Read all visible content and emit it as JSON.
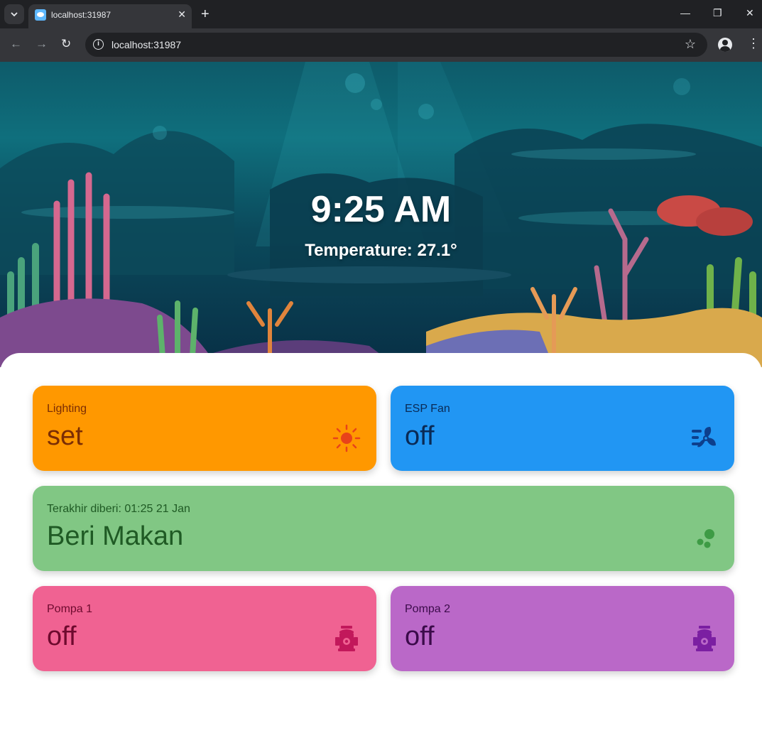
{
  "browser": {
    "tab_title": "localhost:31987",
    "url": "localhost:31987"
  },
  "hero": {
    "time": "9:25 AM",
    "temperature": "Temperature: 27.1°"
  },
  "cards": {
    "lighting": {
      "label": "Lighting",
      "value": "set",
      "icon": "sun-icon",
      "color": "#ff9800"
    },
    "fan": {
      "label": "ESP Fan",
      "value": "off",
      "icon": "fan-icon",
      "color": "#2196f3"
    },
    "feed": {
      "label": "Terakhir diberi: 01:25 21 Jan",
      "value": "Beri Makan",
      "icon": "bubbles-icon",
      "color": "#81c784"
    },
    "pump1": {
      "label": "Pompa 1",
      "value": "off",
      "icon": "pump-icon",
      "color": "#f06292"
    },
    "pump2": {
      "label": "Pompa 2",
      "value": "off",
      "icon": "pump-icon",
      "color": "#ba68c8"
    }
  }
}
